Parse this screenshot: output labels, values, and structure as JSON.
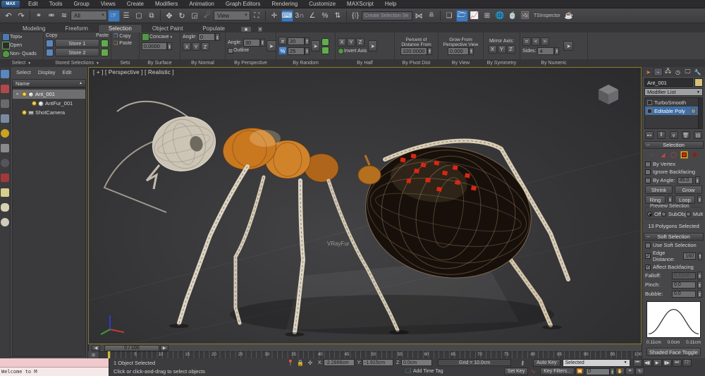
{
  "menubar": {
    "logo": "MAX",
    "items": [
      "Edit",
      "Tools",
      "Group",
      "Views",
      "Create",
      "Modifiers",
      "Animation",
      "Graph Editors",
      "Rendering",
      "Customize",
      "MAXScript",
      "Help"
    ]
  },
  "toolbar": {
    "selection_filter_value": "All",
    "coord_system_value": "View",
    "named_selection_value": "Create Selection Se",
    "tsinspector_label": "TSInspector",
    "snap3_label": "3",
    "percent_label": "%"
  },
  "ribbon": {
    "tabs": [
      {
        "label": "Modeling"
      },
      {
        "label": "Freeform"
      },
      {
        "label": "Selection",
        "active": true
      },
      {
        "label": "Object Paint"
      },
      {
        "label": "Populate"
      }
    ],
    "select_group": {
      "label": "Select",
      "tops": "Tops",
      "open": "Open",
      "nonquads": "Non- Quads"
    },
    "stored": {
      "label": "Stored Selections",
      "copy": "Copy",
      "paste": "Paste",
      "store1": "Store 1",
      "store2": "Store 2"
    },
    "sets": {
      "label": "Sets",
      "copy": "Copy",
      "paste": "Paste"
    },
    "by_surface": {
      "label": "By Surface",
      "mode": "Concave",
      "value": "0.0000"
    },
    "by_normal": {
      "label": "By Normal",
      "angle_label": "Angle:",
      "angle": "0",
      "axes": [
        {
          "t": "X",
          "active": true
        },
        {
          "t": "Y"
        },
        {
          "t": "Z"
        }
      ]
    },
    "by_perspective": {
      "label": "By Perspective",
      "angle_label": "Angle:",
      "angle": "30",
      "outline": "Outline"
    },
    "by_random": {
      "label": "By Random",
      "hash": "#",
      "count": "20",
      "pct": "%",
      "percent": "25"
    },
    "by_half": {
      "label": "By Half",
      "axes": [
        {
          "t": "X",
          "active": true
        },
        {
          "t": "Y"
        },
        {
          "t": "Z"
        }
      ],
      "invert": "Invert Axis"
    },
    "by_pivot": {
      "label": "By Pivot Dist",
      "text1": "Percent of",
      "text2": "Distance From",
      "value": "100.0000"
    },
    "by_view": {
      "label": "By View",
      "text1": "Grow From",
      "text2": "Perspective View",
      "value": "0.000"
    },
    "by_symmetry": {
      "label": "By Symmetry",
      "text": "Mirror Axis:",
      "axes": [
        {
          "t": "X"
        },
        {
          "t": "Y"
        },
        {
          "t": "Z"
        }
      ]
    },
    "by_numeric": {
      "label": "By Numeric",
      "ops": [
        {
          "t": "="
        },
        {
          "t": "<"
        },
        {
          "t": ">",
          "active": true
        }
      ],
      "sides_label": "Sides:",
      "sides": "4"
    }
  },
  "explorer": {
    "menus": [
      "Select",
      "Display",
      "Edit"
    ],
    "name_header": "Name",
    "sort_icon": "▲",
    "nodes": [
      {
        "label": "Ant_001",
        "selected": true,
        "cls_exp": "has-exp"
      },
      {
        "label": "AntFur_001",
        "cls_indent": "indent1"
      },
      {
        "label": "ShotCamera",
        "cls_cam": "cam"
      }
    ]
  },
  "viewport": {
    "label": "[ + ] [ Perspective ] [ Realistic ]",
    "vrayfur_label": "VRayFur"
  },
  "timeline": {
    "slider_value": "0 / 100",
    "ticks": [
      "5",
      "10",
      "15",
      "20",
      "25",
      "30",
      "35",
      "40",
      "45",
      "50",
      "55",
      "60",
      "65",
      "70",
      "75",
      "80",
      "85",
      "90",
      "95",
      "100"
    ]
  },
  "statusbar": {
    "listener_text": "Welcome to M",
    "status_line": "1 Object Selected",
    "prompt_line": "Click or click-and-drag to select objects",
    "x_label": "X:",
    "x_value": "-2.2866cm",
    "y_label": "Y:",
    "y_value": "-1.915cm",
    "z_label": "Z:",
    "z_value": "0.0cm",
    "grid_label": "Grid = 10.0cm",
    "time_tag": "Add Time Tag",
    "auto_key": "Auto Key",
    "set_key": "Set Key",
    "key_mode_value": "Selected",
    "key_filters": "Key Filters...",
    "frame_value": "0"
  },
  "command_panel": {
    "object_name": "Ant_001",
    "modifier_list": "Modifier List",
    "stack": [
      {
        "label": "TurboSmooth"
      },
      {
        "label": "Editable Poly",
        "selected": true
      }
    ],
    "selection": {
      "title": "Selection",
      "by_vertex": "By Vertex",
      "ignore_backfacing": "Ignore Backfacing",
      "by_angle": "By Angle:",
      "angle_value": "45.0",
      "shrink": "Shrink",
      "grow": "Grow",
      "ring": "Ring",
      "loop": "Loop",
      "preview": "Preview Selection",
      "off": "Off",
      "subobj": "SubObj",
      "multi": "Mult",
      "status": "13 Polygons Selected"
    },
    "soft": {
      "title": "Soft Selection",
      "use": "Use Soft Selection",
      "edge_distance": "Edge Distance:",
      "edge_value": "160",
      "affect": "Affect Backfacing",
      "falloff": "Falloff:",
      "falloff_value": "0.11cm",
      "pinch": "Pinch:",
      "pinch_value": "0.0",
      "bubble": "Bubble:",
      "bubble_value": "0.0",
      "axis_left": "0.11cm",
      "axis_mid": "0.0cm",
      "axis_right": "0.11cm",
      "shaded_toggle": "Shaded Face Toggle"
    }
  }
}
